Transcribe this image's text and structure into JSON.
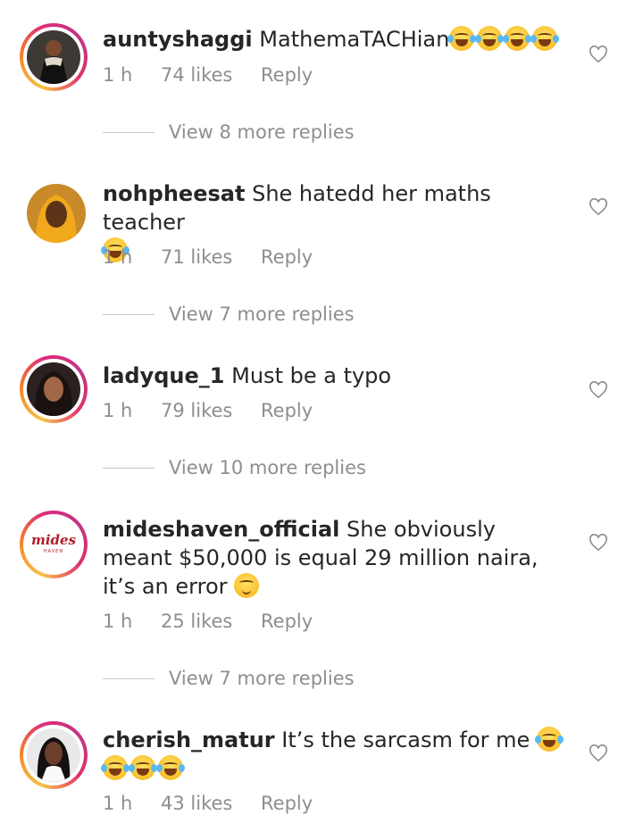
{
  "comments": [
    {
      "username": "auntyshaggi",
      "text": "MathemaTACHian",
      "emojis_after": 4,
      "time": "1 h",
      "likes": "74 likes",
      "reply": "Reply",
      "view_more": "View 8 more replies"
    },
    {
      "username": "nohpheesat",
      "text": "She hatedd her maths teacher",
      "emojis_after": 1,
      "time": "1 h",
      "likes": "71 likes",
      "reply": "Reply",
      "view_more": "View 7 more replies"
    },
    {
      "username": "ladyque_1",
      "text": "Must be a typo",
      "time": "1 h",
      "likes": "79 likes",
      "reply": "Reply",
      "view_more": "View 10 more replies"
    },
    {
      "username": "mideshaven_official",
      "text": "She obviously meant $50,000 is equal 29 million naira, it’s an error",
      "emojis_after": 1,
      "time": "1 h",
      "likes": "25 likes",
      "reply": "Reply",
      "view_more": "View 7 more replies",
      "avatar_logo_text": "mides",
      "avatar_logo_sub": "HAVEN"
    },
    {
      "username": "cherish_matur",
      "text": "It’s the sarcasm for me",
      "emojis_after": 4,
      "time": "1 h",
      "likes": "43 likes",
      "reply": "Reply"
    }
  ],
  "colors": {
    "text": "#262626",
    "meta": "#8e8e8e",
    "ring_start": "#f58529",
    "ring_end": "#dd2a7b"
  },
  "icons": {
    "like": "heart-outline-icon",
    "emoji_laugh": "face-with-tears-of-joy",
    "emoji_relieved": "relieved-face"
  }
}
